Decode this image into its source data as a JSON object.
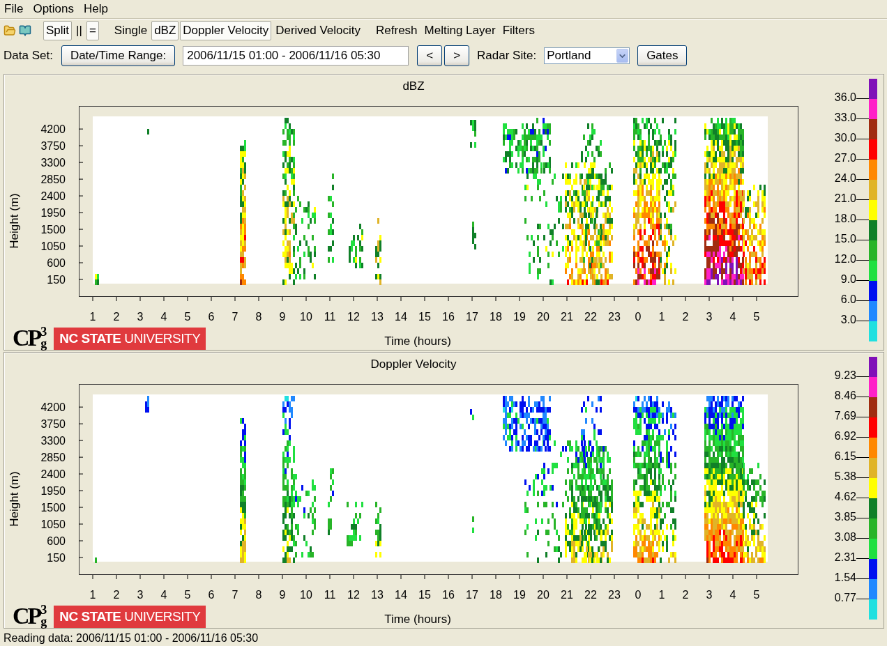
{
  "menu": [
    "File",
    "Options",
    "Help"
  ],
  "toolbar": {
    "layout": [
      {
        "label": "Split",
        "selected": true
      },
      {
        "label": "||",
        "selected": false
      },
      {
        "label": "=",
        "selected": true
      }
    ],
    "products": [
      {
        "label": "Single",
        "selected": false
      },
      {
        "label": "dBZ",
        "selected": true
      },
      {
        "label": "Doppler Velocity",
        "selected": true
      },
      {
        "label": "Derived Velocity",
        "selected": false
      }
    ],
    "actions": [
      "Refresh",
      "Melting Layer",
      "Filters"
    ]
  },
  "data_set": {
    "label": "Data Set:",
    "range_button": "Date/Time Range:",
    "range_value": "2006/11/15 01:00 - 2006/11/16 05:30",
    "prev": "<",
    "next": ">",
    "site_label": "Radar Site:",
    "site_value": "Portland",
    "gates_button": "Gates"
  },
  "panels": [
    {
      "title": "dBZ",
      "y_label": "Height (m)",
      "x_label": "Time (hours)",
      "kind": "reflectivity",
      "y_ticks": [
        "4200",
        "3750",
        "3300",
        "2850",
        "2400",
        "1950",
        "1500",
        "1050",
        "600",
        "150"
      ],
      "x_ticks": [
        "1",
        "2",
        "3",
        "4",
        "5",
        "6",
        "7",
        "8",
        "9",
        "10",
        "11",
        "12",
        "13",
        "14",
        "15",
        "16",
        "17",
        "18",
        "19",
        "20",
        "21",
        "22",
        "23",
        "0",
        "1",
        "2",
        "3",
        "4",
        "5"
      ],
      "colorbar": {
        "labels": [
          "36.0",
          "33.0",
          "30.0",
          "27.0",
          "24.0",
          "21.0",
          "18.0",
          "15.0",
          "12.0",
          "9.0",
          "6.0",
          "3.0"
        ],
        "segments": [
          {
            "color": "#8010b8"
          },
          {
            "color": "#ff20c8"
          },
          {
            "color": "#a02c10"
          },
          {
            "color": "#ff0000"
          },
          {
            "color": "#ff8800"
          },
          {
            "color": "#e0b428"
          },
          {
            "color": "#ffff00"
          },
          {
            "color": "#108028"
          },
          {
            "color": "#28b428"
          },
          {
            "color": "#20e040"
          },
          {
            "color": "#0010f0"
          },
          {
            "color": "#2088ff"
          },
          {
            "color": "#20e0e0"
          }
        ]
      },
      "logo": {
        "letters": "CP",
        "superscript": "3",
        "subscript": "g"
      },
      "university": "**NC STATE** UNIVERSITY"
    },
    {
      "title": "Doppler Velocity",
      "y_label": "Height (m)",
      "x_label": "Time (hours)",
      "kind": "velocity",
      "y_ticks": [
        "4200",
        "3750",
        "3300",
        "2850",
        "2400",
        "1950",
        "1500",
        "1050",
        "600",
        "150"
      ],
      "x_ticks": [
        "1",
        "2",
        "3",
        "4",
        "5",
        "6",
        "7",
        "8",
        "9",
        "10",
        "11",
        "12",
        "13",
        "14",
        "15",
        "16",
        "17",
        "18",
        "19",
        "20",
        "21",
        "22",
        "23",
        "0",
        "1",
        "2",
        "3",
        "4",
        "5"
      ],
      "colorbar": {
        "labels": [
          "9.23",
          "8.46",
          "7.69",
          "6.92",
          "6.15",
          "5.38",
          "4.62",
          "3.85",
          "3.08",
          "2.31",
          "1.54",
          "0.77"
        ],
        "segments": [
          {
            "color": "#8010b8"
          },
          {
            "color": "#ff20c8"
          },
          {
            "color": "#a02c10"
          },
          {
            "color": "#ff0000"
          },
          {
            "color": "#ff8800"
          },
          {
            "color": "#e0b428"
          },
          {
            "color": "#ffff00"
          },
          {
            "color": "#108028"
          },
          {
            "color": "#28b428"
          },
          {
            "color": "#20e040"
          },
          {
            "color": "#0010f0"
          },
          {
            "color": "#2088ff"
          },
          {
            "color": "#20e0e0"
          }
        ]
      },
      "logo": {
        "letters": "CP",
        "superscript": "3",
        "subscript": "g"
      },
      "university": "**NC STATE** UNIVERSITY"
    }
  ],
  "status": "Reading data: 2006/11/15 01:00 - 2006/11/16 05:30"
}
